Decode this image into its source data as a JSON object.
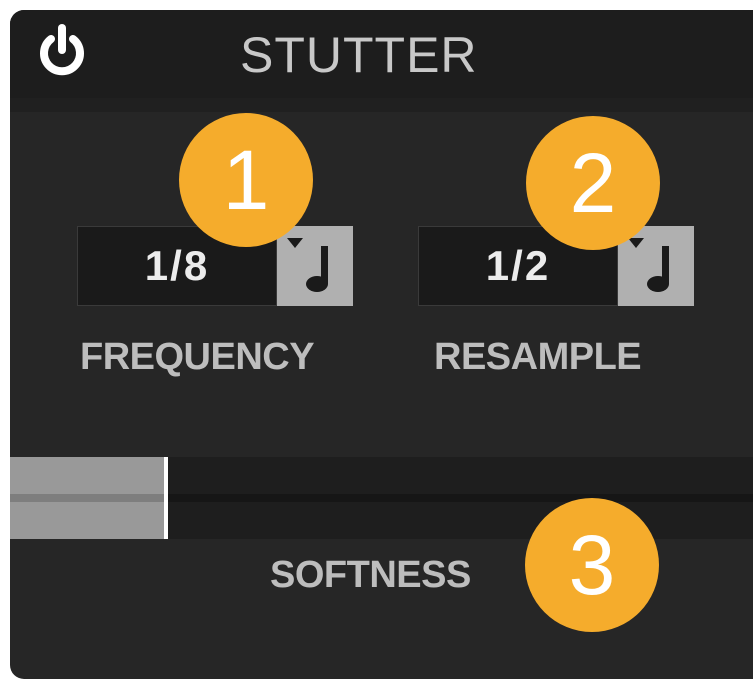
{
  "device": {
    "title": "STUTTER",
    "power_icon": "power-icon"
  },
  "frequency": {
    "value": "1/8",
    "label": "FREQUENCY",
    "sync_icon": "quarter-note-icon"
  },
  "resample": {
    "value": "1/2",
    "label": "RESAMPLE",
    "sync_icon": "quarter-note-icon"
  },
  "softness": {
    "label": "SOFTNESS",
    "level": 0.21
  },
  "callouts": [
    "1",
    "2",
    "3"
  ],
  "colors": {
    "panel": "#262626",
    "header": "#1d1d1d",
    "callout": "#f5ac2c",
    "slider_fill": "#999999",
    "label": "#bdbdbd"
  }
}
